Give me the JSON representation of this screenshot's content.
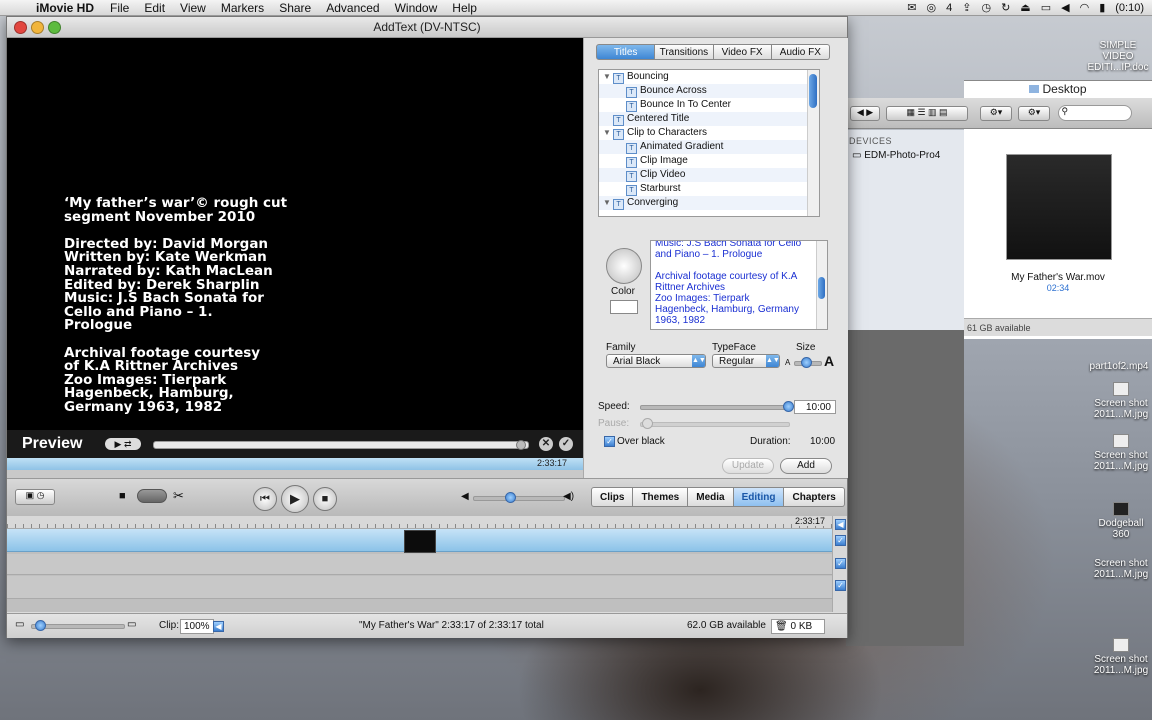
{
  "menubar": {
    "app": "iMovie HD",
    "menus": [
      "File",
      "Edit",
      "View",
      "Markers",
      "Share",
      "Advanced",
      "Window",
      "Help"
    ],
    "clock": "(0:10)",
    "status_extra": "4"
  },
  "window": {
    "title": "AddText (DV-NTSC)"
  },
  "preview": {
    "text": "‘My father’s war’© rough cut\nsegment November 2010\n\nDirected by: David Morgan\nWritten by: Kate Werkman\nNarrated by: Kath MacLean\nEdited by: Derek Sharplin\nMusic: J.S Bach Sonata for\nCello and Piano – 1.\nPrologue\n\nArchival footage courtesy\nof K.A Rittner Archives\nZoo Images: Tierpark\nHagenbeck, Hamburg,\nGermany 1963, 1982",
    "label": "Preview",
    "timecode": "2:33:17"
  },
  "panel": {
    "tabs": [
      "Titles",
      "Transitions",
      "Video FX",
      "Audio FX"
    ],
    "titles": [
      {
        "label": "Bouncing",
        "level": 0,
        "group": true
      },
      {
        "label": "Bounce Across",
        "level": 1
      },
      {
        "label": "Bounce In To Center",
        "level": 1
      },
      {
        "label": "Centered Title",
        "level": 0
      },
      {
        "label": "Clip to Characters",
        "level": 0,
        "group": true
      },
      {
        "label": "Animated Gradient",
        "level": 1
      },
      {
        "label": "Clip Image",
        "level": 1
      },
      {
        "label": "Clip Video",
        "level": 1
      },
      {
        "label": "Starburst",
        "level": 1
      },
      {
        "label": "Converging",
        "level": 0,
        "group": true
      }
    ],
    "color_label": "Color",
    "text_content": "Music: J.S Bach Sonata for Cello\nand Piano – 1. Prologue\n\nArchival footage courtesy of K.A\nRittner Archives\nZoo Images: Tierpark\nHagenbeck, Hamburg, Germany\n1963, 1982",
    "family_label": "Family",
    "family_value": "Arial Black",
    "typeface_label": "TypeFace",
    "typeface_value": "Regular",
    "size_label": "Size",
    "size_small": "A",
    "size_large": "A",
    "speed_label": "Speed:",
    "speed_value": "10:00",
    "pause_label": "Pause:",
    "over_black_label": "Over black",
    "duration_label": "Duration:",
    "duration_value": "10:00",
    "update_label": "Update",
    "add_label": "Add"
  },
  "toolbar": {
    "modes": [
      "Clips",
      "Themes",
      "Media",
      "Editing",
      "Chapters"
    ],
    "active_mode": "Editing"
  },
  "timeline": {
    "timecode": "2:33:17"
  },
  "status": {
    "clip_label": "Clip:",
    "zoom": "100%",
    "project_info": "\"My Father's War\"  2:33:17 of 2:33:17 total",
    "available": "62.0 GB available",
    "trash": "0 KB"
  },
  "finder": {
    "title": "Desktop",
    "devices_label": "DEVICES",
    "device": "EDM-Photo-Pro4",
    "file_name": "My Father's War.mov",
    "file_duration": "02:34",
    "available": "61 GB available"
  },
  "desktop_icons": [
    {
      "label": "SIMPLE VIDEO\nEDITI...IP.doc"
    },
    {
      "label": "part1of2.mp4"
    },
    {
      "label": "Screen shot\n2011...M.jpg"
    },
    {
      "label": "Screen shot\n2011...M.jpg"
    },
    {
      "label": "Dodgeball\n360"
    },
    {
      "label": "Screen shot\n2011...M.jpg"
    },
    {
      "label": "Screen shot\n2011...M.jpg"
    }
  ]
}
